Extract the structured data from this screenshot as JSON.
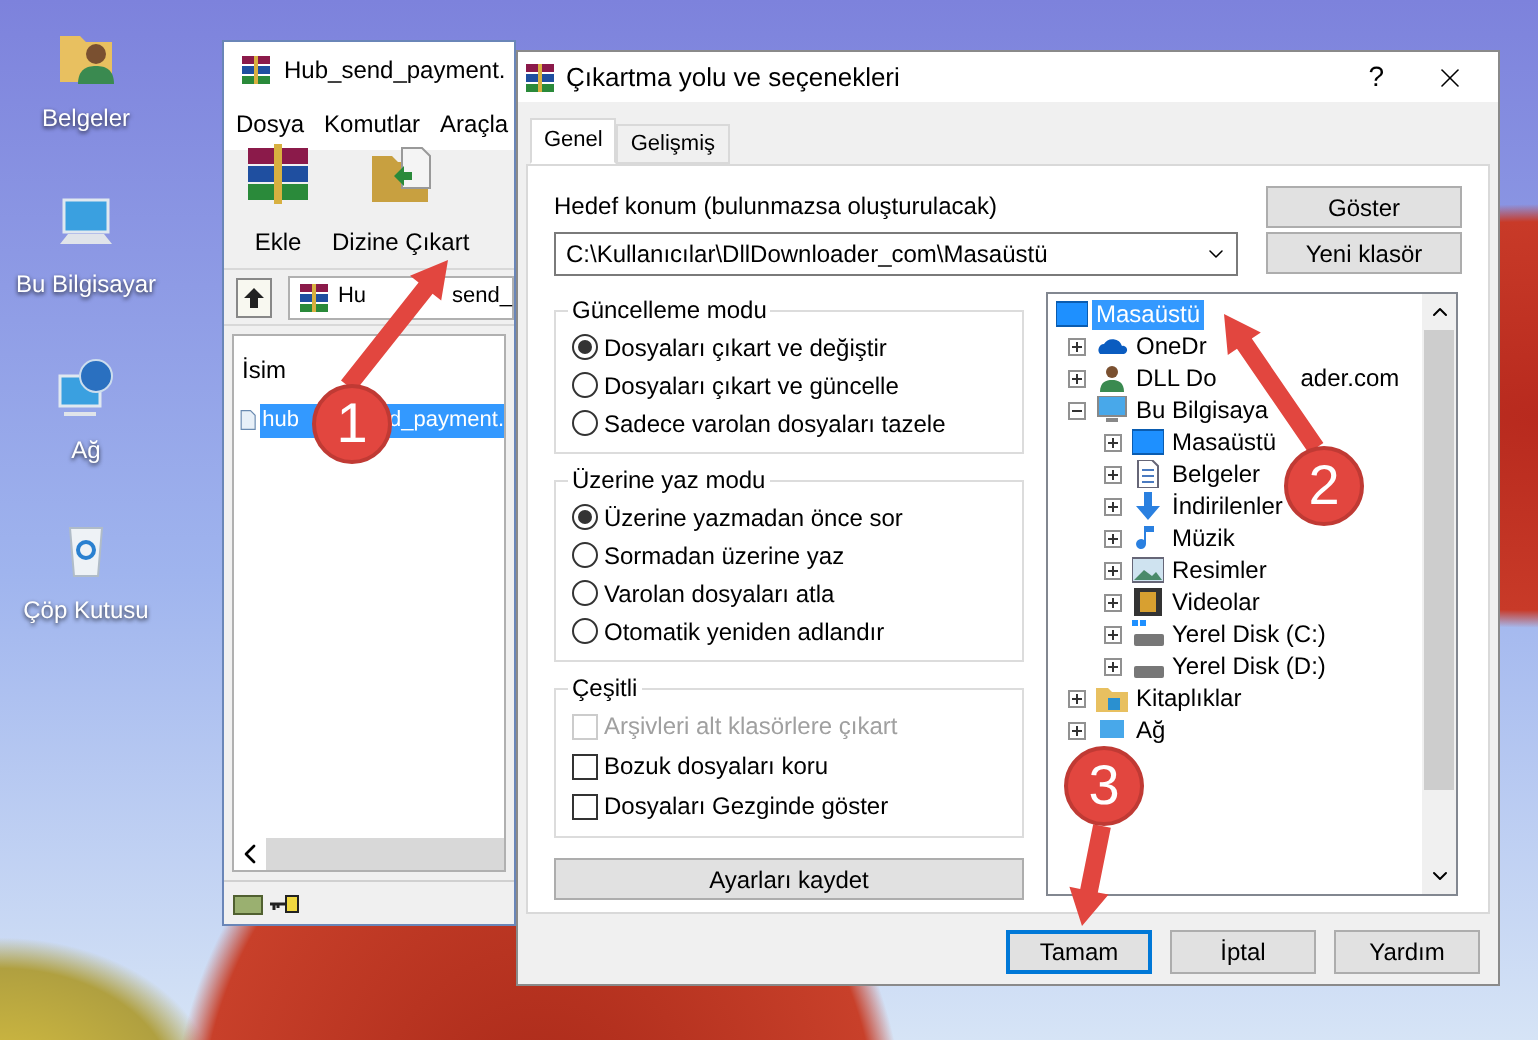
{
  "desktop_icons": [
    {
      "label": "Belgeler"
    },
    {
      "label": "Bu Bilgisayar"
    },
    {
      "label": "Ağ"
    },
    {
      "label": "Çöp Kutusu"
    }
  ],
  "archive_window": {
    "title": "Hub_send_payment.",
    "menu": [
      "Dosya",
      "Komutlar",
      "Araçla"
    ],
    "toolbar": [
      {
        "label": "Ekle"
      },
      {
        "label": "Dizine Çıkart"
      }
    ],
    "path": [
      "Hu",
      "send_"
    ],
    "column": "İsim",
    "file": {
      "name_parts": [
        "hub",
        "d_payment."
      ],
      "selected": true
    }
  },
  "dialog": {
    "title": "Çıkartma yolu ve seçenekleri",
    "help": "?",
    "tabs": [
      {
        "label": "Genel",
        "selected": true
      },
      {
        "label": "Gelişmiş",
        "selected": false
      }
    ],
    "destination_label": "Hedef konum (bulunmazsa oluşturulacak)",
    "destination": "C:\\Kullanıcılar\\DllDownloader_com\\Masaüstü",
    "side_buttons": [
      "Göster",
      "Yeni klasör"
    ],
    "update_mode": {
      "title": "Güncelleme modu",
      "options": [
        {
          "label": "Dosyaları çıkart ve değiştir",
          "selected": true
        },
        {
          "label": "Dosyaları çıkart ve güncelle",
          "selected": false
        },
        {
          "label": "Sadece varolan dosyaları tazele",
          "selected": false
        }
      ]
    },
    "overwrite_mode": {
      "title": "Üzerine yaz modu",
      "options": [
        {
          "label": "Üzerine yazmadan önce sor",
          "selected": true
        },
        {
          "label": "Sormadan üzerine yaz",
          "selected": false
        },
        {
          "label": "Varolan dosyaları atla",
          "selected": false
        },
        {
          "label": "Otomatik yeniden adlandır",
          "selected": false
        }
      ]
    },
    "misc": {
      "title": "Çeşitli",
      "options": [
        {
          "label": "Arşivleri alt klasörlere çıkart",
          "checked": false,
          "disabled": true
        },
        {
          "label": "Bozuk dosyaları koru",
          "checked": false,
          "disabled": false
        },
        {
          "label": "Dosyaları Gezginde göster",
          "checked": false,
          "disabled": false
        }
      ]
    },
    "save_button": "Ayarları kaydet",
    "tree": [
      {
        "label": "Masaüstü",
        "selected": true,
        "children": [
          {
            "label": "OneDr",
            "selected": false,
            "expanded": false
          },
          {
            "label": "DLL Do",
            "label_after_arrow": "ader.com",
            "selected": false,
            "expanded": false
          },
          {
            "label": "Bu Bilgisaya",
            "selected": false,
            "expanded": true,
            "children": [
              {
                "label": "Masaüstü",
                "selected": false,
                "expanded": false
              },
              {
                "label": "Belgeler",
                "selected": false,
                "expanded": false
              },
              {
                "label": "İndirilenler",
                "selected": false,
                "expanded": false
              },
              {
                "label": "Müzik",
                "selected": false,
                "expanded": false
              },
              {
                "label": "Resimler",
                "selected": false,
                "expanded": false
              },
              {
                "label": "Videolar",
                "selected": false,
                "expanded": false
              },
              {
                "label": "Yerel Disk (C:)",
                "selected": false,
                "expanded": false
              },
              {
                "label": "Yerel Disk (D:)",
                "selected": false,
                "expanded": false
              }
            ]
          },
          {
            "label": "Kitaplıklar",
            "selected": false,
            "expanded": false
          },
          {
            "label": "Ağ",
            "selected": false,
            "expanded": false
          }
        ]
      }
    ],
    "buttons": [
      {
        "label": "Tamam",
        "focused": true
      },
      {
        "label": "İptal",
        "focused": false
      },
      {
        "label": "Yardım",
        "focused": false
      }
    ]
  },
  "annotations": [
    {
      "label": "1"
    },
    {
      "label": "2"
    },
    {
      "label": "3"
    }
  ]
}
